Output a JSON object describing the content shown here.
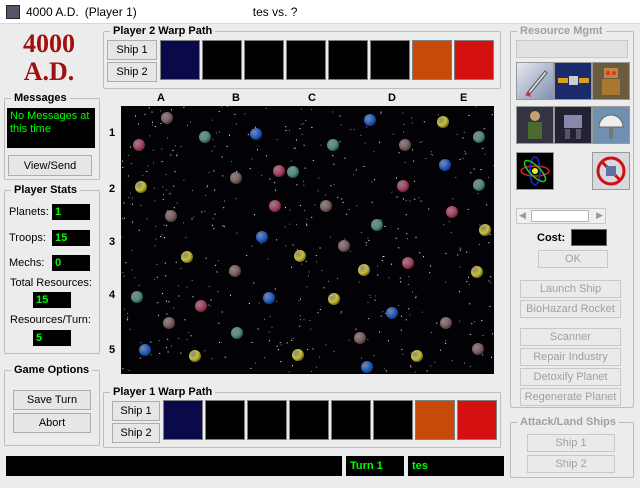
{
  "window": {
    "app": "4000 A.D.",
    "player": "(Player 1)",
    "match": "tes vs. ?"
  },
  "logo": {
    "line1": "4000",
    "line2": "A.D."
  },
  "messages": {
    "title": "Messages",
    "text": "No Messages at this time",
    "view_send": "View/Send"
  },
  "player_stats": {
    "title": "Player Stats",
    "planets_label": "Planets:",
    "planets": "1",
    "troops_label": "Troops:",
    "troops": "15",
    "mechs_label": "Mechs:",
    "mechs": "0",
    "total_label": "Total Resources:",
    "total": "15",
    "rpt_label": "Resources/Turn:",
    "rpt": "5"
  },
  "game_options": {
    "title": "Game Options",
    "save": "Save Turn",
    "abort": "Abort"
  },
  "p2_warp": {
    "title": "Player 2 Warp Path",
    "ship1": "Ship 1",
    "ship2": "Ship 2",
    "colors": [
      "#0a0a4a",
      "#000000",
      "#000000",
      "#000000",
      "#000000",
      "#000000",
      "#c84a0a",
      "#d41010"
    ]
  },
  "p1_warp": {
    "title": "Player 1 Warp Path",
    "ship1": "Ship 1",
    "ship2": "Ship 2",
    "colors": [
      "#0a0a4a",
      "#000000",
      "#000000",
      "#000000",
      "#000000",
      "#000000",
      "#c84a0a",
      "#d41010"
    ]
  },
  "map": {
    "columns": [
      "A",
      "B",
      "C",
      "D",
      "E"
    ],
    "rows": [
      "1",
      "2",
      "3",
      "4",
      "5"
    ],
    "planet_colors": {
      "red": "#b04060",
      "blue": "#2060d0",
      "gray": "#509080",
      "yellow": "#c8c030",
      "brown": "#806060"
    }
  },
  "resource": {
    "title": "Resource Mgmt",
    "icons": [
      "missile-icon",
      "satellite-icon",
      "robot-icon",
      "soldier-icon",
      "mech-icon",
      "radar-icon",
      "atom-icon",
      "empty-slot",
      "no-biohazard-icon"
    ],
    "cost_label": "Cost:",
    "ok": "OK",
    "launch": "Launch Ship",
    "biohazard": "BioHazard Rocket",
    "scanner": "Scanner",
    "repair": "Repair Industry",
    "detoxify": "Detoxify Planet",
    "regenerate": "Regenerate Planet"
  },
  "attack": {
    "title": "Attack/Land Ships",
    "ship1": "Ship 1",
    "ship2": "Ship 2"
  },
  "status": {
    "left": "",
    "turn": "Turn  1",
    "name": "tes"
  }
}
